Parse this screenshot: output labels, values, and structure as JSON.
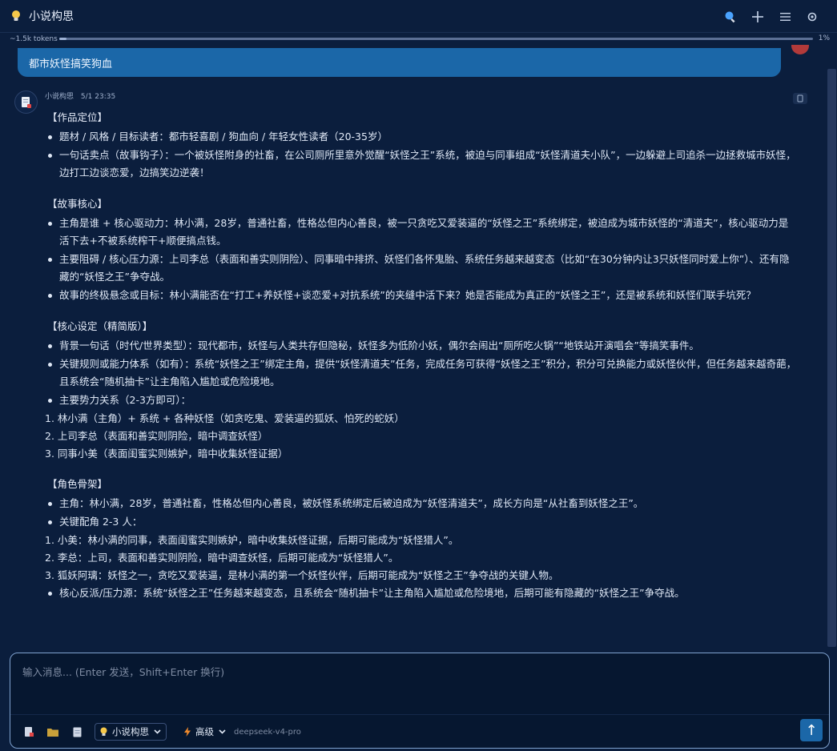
{
  "titlebar": {
    "title": "小说构思",
    "icons": [
      "lightbulb-icon",
      "search-icon",
      "plus-icon",
      "menu-icon",
      "settings-icon"
    ]
  },
  "tokens": {
    "label": "~1.5k tokens",
    "percent_text": "1%",
    "progress": 0.01
  },
  "user_message": {
    "text": "都市妖怪搞笑狗血"
  },
  "assistant": {
    "name": "小说构思",
    "timestamp": "5/1 23:35",
    "sections": [
      {
        "title": "【作品定位】",
        "items": [
          {
            "type": "bullet",
            "text": "题材 / 风格 / 目标读者：都市轻喜剧 / 狗血向 / 年轻女性读者（20-35岁）"
          },
          {
            "type": "bullet",
            "text": "一句话卖点（故事钩子）：一个被妖怪附身的社畜，在公司厕所里意外觉醒“妖怪之王”系统，被迫与同事组成“妖怪清道夫小队”，一边躲避上司追杀一边拯救城市妖怪，边打工边谈恋爱，边搞笑边逆袭！"
          }
        ]
      },
      {
        "title": "【故事核心】",
        "items": [
          {
            "type": "bullet",
            "text": "主角是谁 + 核心驱动力：林小满，28岁，普通社畜，性格怂但内心善良，被一只贪吃又爱装逼的“妖怪之王”系统绑定，被迫成为城市妖怪的“清道夫”，核心驱动力是活下去+不被系统榨干+顺便搞点钱。"
          },
          {
            "type": "bullet",
            "text": "主要阻碍 / 核心压力源：上司李总（表面和善实则阴险）、同事暗中排挤、妖怪们各怀鬼胎、系统任务越来越变态（比如“在30分钟内让3只妖怪同时爱上你”）、还有隐藏的“妖怪之王”争夺战。"
          },
          {
            "type": "bullet",
            "text": "故事的终极悬念或目标：林小满能否在“打工+养妖怪+谈恋爱+对抗系统”的夹缝中活下来？她是否能成为真正的“妖怪之王”，还是被系统和妖怪们联手坑死？"
          }
        ]
      },
      {
        "title": "【核心设定（精简版）】",
        "items": [
          {
            "type": "bullet",
            "text": "背景一句话（时代/世界类型）：现代都市，妖怪与人类共存但隐秘，妖怪多为低阶小妖，偶尔会闹出“厕所吃火锅”“地铁站开演唱会”等搞笑事件。"
          },
          {
            "type": "bullet",
            "text": "关键规则或能力体系（如有）：系统“妖怪之王”绑定主角，提供“妖怪清道夫”任务，完成任务可获得“妖怪之王”积分，积分可兑换能力或妖怪伙伴，但任务越来越奇葩，且系统会“随机抽卡”让主角陷入尴尬或危险境地。"
          },
          {
            "type": "bullet",
            "text": "主要势力关系（2-3方即可）："
          },
          {
            "type": "ordered",
            "text": "1. 林小满（主角）+ 系统 + 各种妖怪（如贪吃鬼、爱装逼的狐妖、怕死的蛇妖）"
          },
          {
            "type": "ordered",
            "text": "2. 上司李总（表面和善实则阴险，暗中调查妖怪）"
          },
          {
            "type": "ordered",
            "text": "3. 同事小美（表面闺蜜实则嫉妒，暗中收集妖怪证据）"
          }
        ]
      },
      {
        "title": "【角色骨架】",
        "items": [
          {
            "type": "bullet",
            "text": "主角：林小满，28岁，普通社畜，性格怂但内心善良，被妖怪系统绑定后被迫成为“妖怪清道夫”，成长方向是“从社畜到妖怪之王”。"
          },
          {
            "type": "bullet",
            "text": "关键配角 2-3 人："
          },
          {
            "type": "ordered",
            "text": "1. 小美：林小满的同事，表面闺蜜实则嫉妒，暗中收集妖怪证据，后期可能成为“妖怪猎人”。"
          },
          {
            "type": "ordered",
            "text": "2. 李总：上司，表面和善实则阴险，暗中调查妖怪，后期可能成为“妖怪猎人”。"
          },
          {
            "type": "ordered",
            "text": "3. 狐妖阿璃：妖怪之一，贪吃又爱装逼，是林小满的第一个妖怪伙伴，后期可能成为“妖怪之王”争夺战的关键人物。"
          },
          {
            "type": "bullet",
            "text": "核心反派/压力源：系统“妖怪之王”任务越来越变态，且系统会“随机抽卡”让主角陷入尴尬或危险境地，后期可能有隐藏的“妖怪之王”争夺战。"
          }
        ]
      }
    ]
  },
  "input": {
    "placeholder": "输入消息... (Enter 发送，Shift+Enter 换行)",
    "agent_select": "小说构思",
    "level_select": "高级",
    "model_name": "deepseek-v4-pro",
    "send_label": "↑"
  },
  "colors": {
    "background": "#0b1e3d",
    "user_bubble": "#1b67a8",
    "accent": "#1b67a8",
    "input_border": "#7fa2cf"
  }
}
